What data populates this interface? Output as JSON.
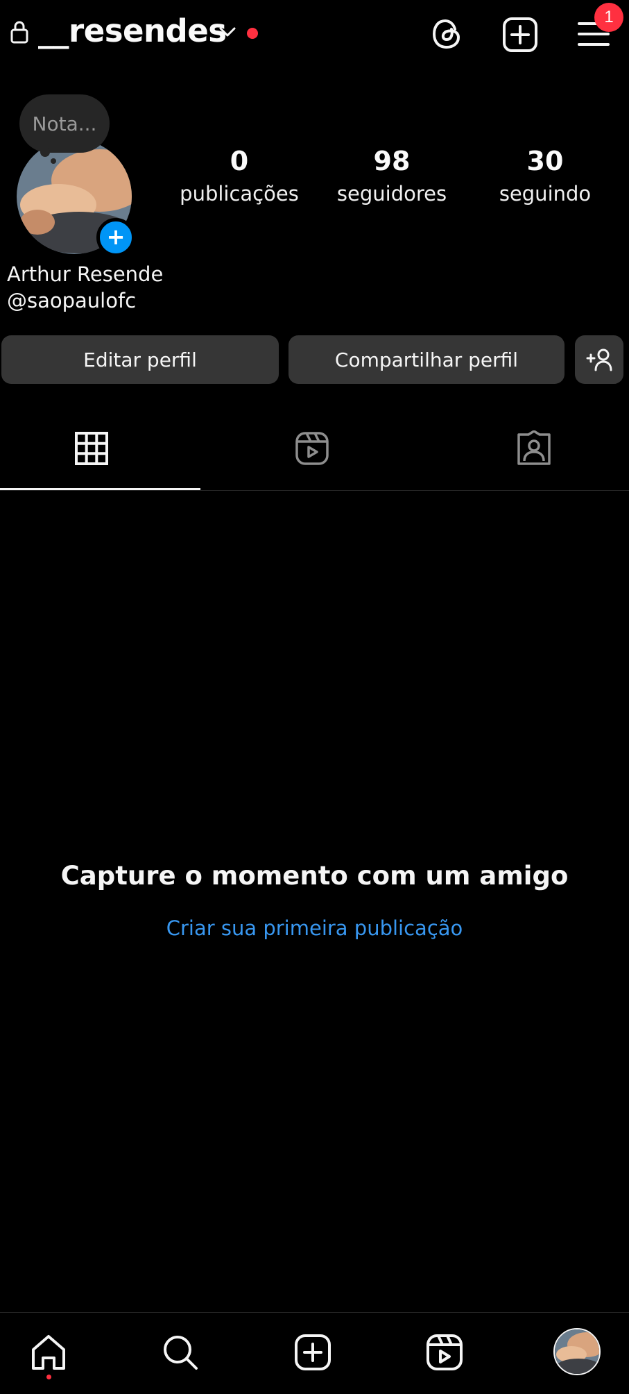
{
  "header": {
    "username": "__resendes",
    "menu_badge": "1"
  },
  "profile": {
    "note_placeholder": "Nota...",
    "add_story_symbol": "+",
    "full_name": "Arthur Resende",
    "handle": "@saopaulofc"
  },
  "stats": [
    {
      "value": "0",
      "label": "publicações"
    },
    {
      "value": "98",
      "label": "seguidores"
    },
    {
      "value": "30",
      "label": "seguindo"
    }
  ],
  "buttons": {
    "edit_profile": "Editar perfil",
    "share_profile": "Compartilhar perfil"
  },
  "tabs": [
    {
      "name": "grid-icon",
      "active": true
    },
    {
      "name": "reels-icon",
      "active": false
    },
    {
      "name": "tagged-icon",
      "active": false
    }
  ],
  "empty_state": {
    "title": "Capture o momento com um amigo",
    "link": "Criar sua primeira publicação"
  },
  "bottom_nav": [
    {
      "name": "home-icon",
      "active": true
    },
    {
      "name": "search-icon",
      "active": false
    },
    {
      "name": "create-icon",
      "active": false
    },
    {
      "name": "reels-icon",
      "active": false
    },
    {
      "name": "profile-avatar",
      "active": false
    }
  ],
  "colors": {
    "background": "#000000",
    "button": "#363636",
    "accent_blue": "#0095f6",
    "link_blue": "#3897f0",
    "notification_red": "#ff3040"
  }
}
